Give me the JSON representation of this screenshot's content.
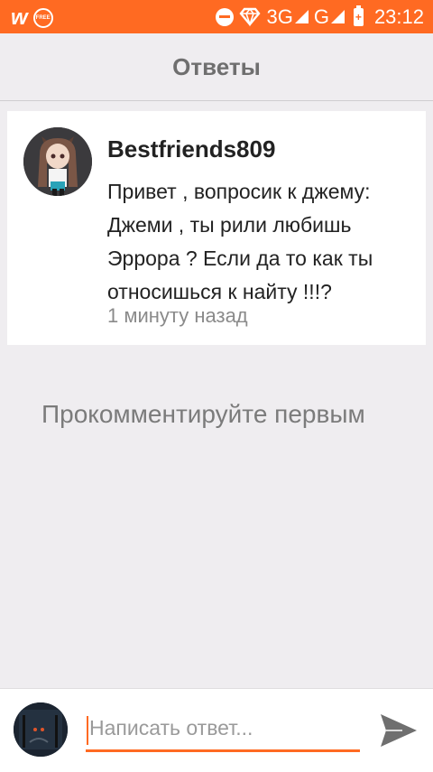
{
  "status_bar": {
    "app_logo": "w",
    "free_badge": "FREE",
    "network_1": "3G",
    "network_2": "G",
    "battery_symbol": "+",
    "time": "23:12",
    "icons": [
      "w-logo-icon",
      "free-icon",
      "dnd-icon",
      "vpn-icon",
      "signal-icon",
      "signal-icon",
      "battery-icon"
    ],
    "background": "#ff6a22"
  },
  "header": {
    "title": "Ответы"
  },
  "post": {
    "author": "Bestfriends809",
    "text": "Привет , вопросик к джему: Джеми , ты рили любишь Эррора ? Если да то как ты относишься к найту !!!?",
    "time": "1 минуту назад"
  },
  "empty_state": {
    "text": "Прокомментируйте первым"
  },
  "reply": {
    "placeholder": "Написать ответ...",
    "value": "",
    "send_icon": "send-icon"
  },
  "colors": {
    "accent": "#ff6a22",
    "background": "#efedf0",
    "card": "#ffffff"
  }
}
